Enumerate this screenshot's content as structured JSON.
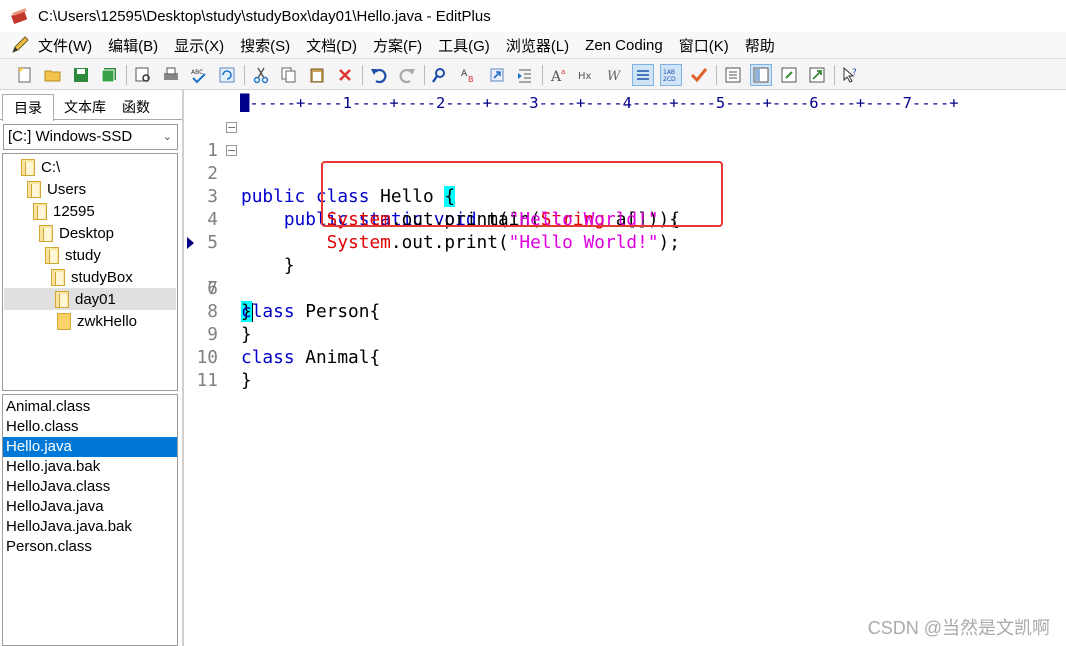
{
  "window": {
    "title": "C:\\Users\\12595\\Desktop\\study\\studyBox\\day01\\Hello.java - EditPlus"
  },
  "menu": [
    "文件(W)",
    "编辑(B)",
    "显示(X)",
    "搜索(S)",
    "文档(D)",
    "方案(F)",
    "工具(G)",
    "浏览器(L)",
    "Zen Coding",
    "窗口(K)",
    "帮助"
  ],
  "sidebar": {
    "tabs": [
      "目录",
      "文本库",
      "函数"
    ],
    "drive": "[C:] Windows-SSD",
    "tree": [
      {
        "label": "C:\\"
      },
      {
        "label": "Users"
      },
      {
        "label": "12595"
      },
      {
        "label": "Desktop"
      },
      {
        "label": "study"
      },
      {
        "label": "studyBox"
      },
      {
        "label": "day01"
      },
      {
        "label": "zwkHello"
      }
    ],
    "files": [
      "Animal.class",
      "Hello.class",
      "Hello.java",
      "Hello.java.bak",
      "HelloJava.class",
      "HelloJava.java",
      "HelloJava.java.bak",
      "Person.class"
    ]
  },
  "editor": {
    "ruler": "-----+----1----+----2----+----3----+----4----+----5----+----6----+----7----+",
    "line_numbers": [
      "1",
      "2",
      "3",
      "4",
      "5",
      "6",
      "7",
      "8",
      "9",
      "10",
      "11"
    ],
    "code": {
      "l1_kw": "public class",
      "l1_rest": " Hello ",
      "l1_brace": "{",
      "l2_indent": "    ",
      "l2_kw": "public static void",
      "l2_mid": " main(",
      "l2_type": "String",
      "l2_rest": " a[]) {",
      "l3_indent": "        ",
      "l3_cls": "System",
      "l3_mid": ".out.print(",
      "l3_str": "\"Hello World!\"",
      "l3_end": ");",
      "l4_indent": "        ",
      "l4_cls": "System",
      "l4_mid": ".out.print(",
      "l4_str": "\"Hello World!\"",
      "l4_end": ");",
      "l5": "    }",
      "l6_brace": "}",
      "l7_kw": "class",
      "l7_rest": " Person{",
      "l8": "}",
      "l9_kw": "class",
      "l9_rest": " Animal{",
      "l10": "}"
    }
  },
  "watermark": "CSDN @当然是文凯啊",
  "colors": {
    "keyword": "#0000cc",
    "class": "#e00000",
    "string": "#e000e0",
    "highlight": "#00ffff",
    "annotation_box": "#e53935",
    "selection": "#0078d7"
  }
}
